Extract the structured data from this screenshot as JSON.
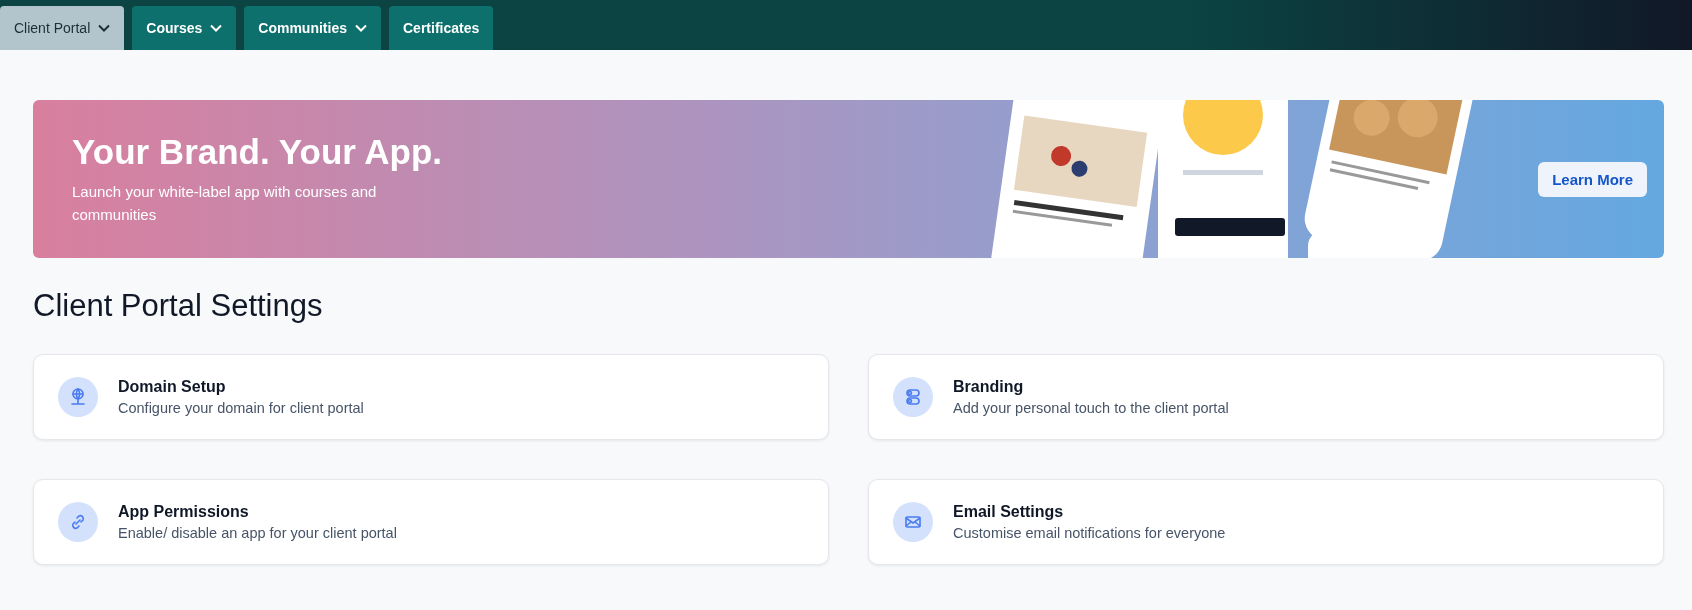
{
  "nav": {
    "tabs": [
      {
        "label": "Client Portal",
        "selected": true,
        "has_menu": true
      },
      {
        "label": "Courses",
        "selected": false,
        "has_menu": true
      },
      {
        "label": "Communities",
        "selected": false,
        "has_menu": true
      },
      {
        "label": "Certificates",
        "selected": false,
        "has_menu": false
      }
    ]
  },
  "banner": {
    "title": "Your Brand. Your App.",
    "subtitle": "Launch your white-label app with courses and communities",
    "button": "Learn More"
  },
  "heading": "Client Portal Settings",
  "cards": [
    {
      "kind": "globe",
      "title": "Domain Setup",
      "description": "Configure your domain for client portal"
    },
    {
      "kind": "toggles",
      "title": "Branding",
      "description": "Add your personal touch to the client portal"
    },
    {
      "kind": "link",
      "title": "App Permissions",
      "description": "Enable/ disable an app for your client portal"
    },
    {
      "kind": "mail",
      "title": "Email Settings",
      "description": "Customise email notifications for everyone"
    }
  ]
}
